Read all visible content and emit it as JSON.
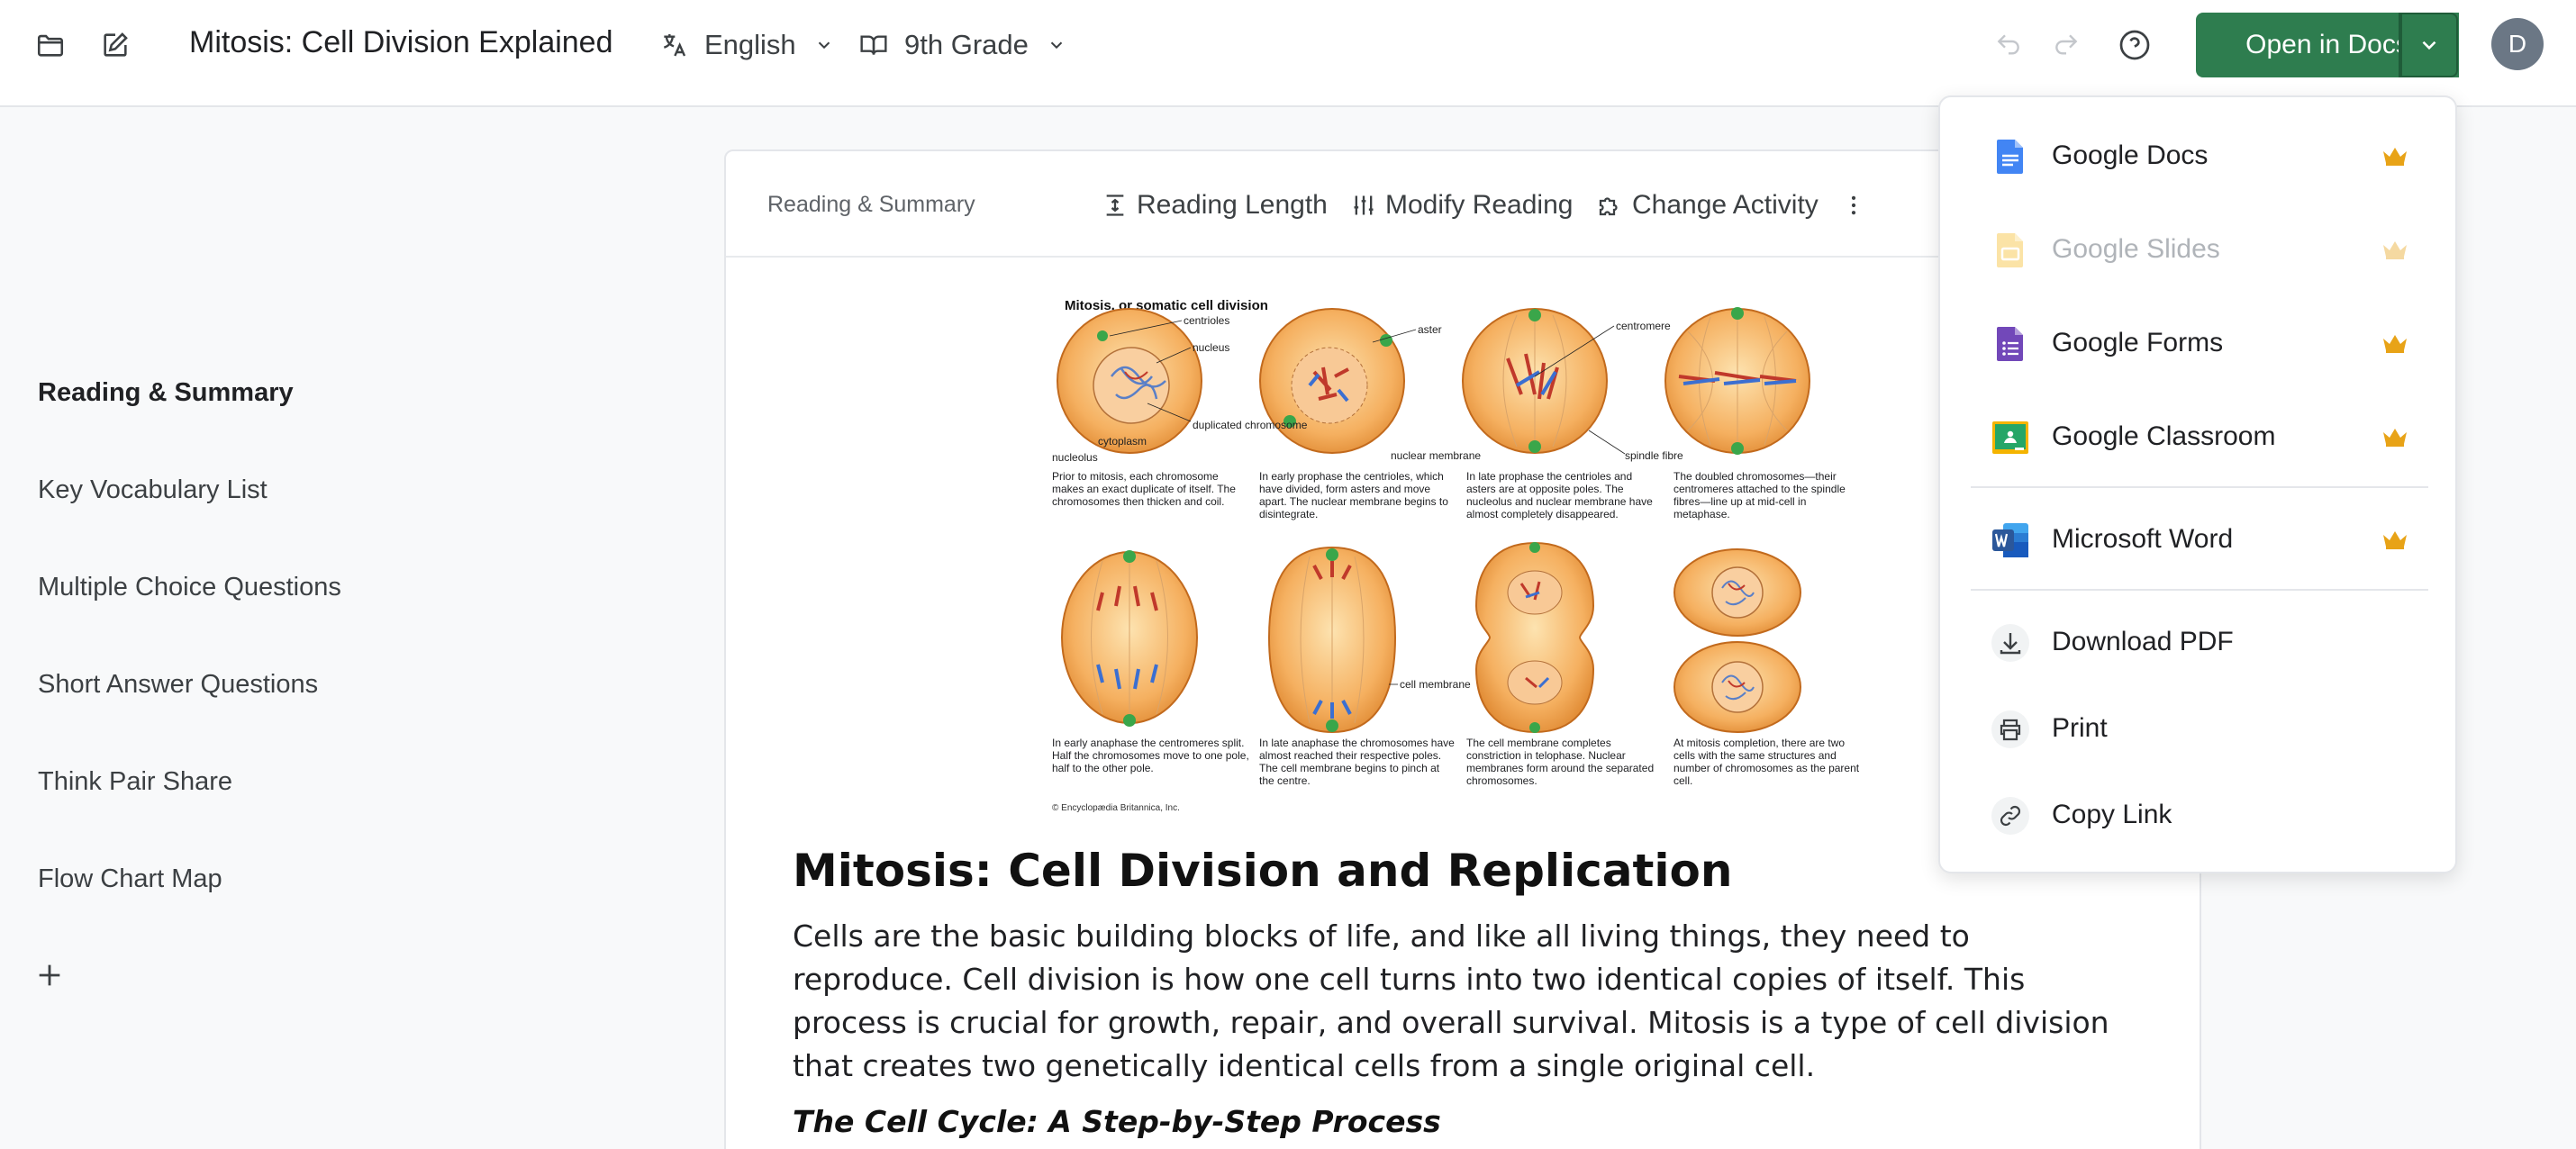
{
  "header": {
    "title": "Mitosis: Cell Division Explained",
    "language": "English",
    "grade": "9th Grade",
    "open_button_label": "Open in Docs",
    "avatar_initial": "D"
  },
  "sidebar": {
    "items": [
      {
        "label": "Reading & Summary",
        "active": true
      },
      {
        "label": "Key Vocabulary List"
      },
      {
        "label": "Multiple Choice Questions"
      },
      {
        "label": "Short Answer Questions"
      },
      {
        "label": "Think Pair Share"
      },
      {
        "label": "Flow Chart Map"
      }
    ]
  },
  "card": {
    "section_label": "Reading & Summary",
    "tools": {
      "reading_length": "Reading Length",
      "modify_reading": "Modify Reading",
      "change_activity": "Change Activity"
    },
    "figure": {
      "title": "Mitosis, or somatic cell division",
      "labels": {
        "centrioles": "centrioles",
        "nucleus": "nucleus",
        "duplicated_chromosome": "duplicated chromosome",
        "cytoplasm": "cytoplasm",
        "nucleolus": "nucleolus",
        "aster": "aster",
        "nuclear_membrane": "nuclear membrane",
        "centromere": "centromere",
        "spindle_fibre": "spindle fibre",
        "cell_membrane": "cell membrane"
      },
      "captions": [
        "Prior to mitosis, each chromosome makes an exact duplicate of itself. The chromosomes then thicken and coil.",
        "In early prophase the centrioles, which have divided, form asters and move apart. The nuclear membrane begins to disintegrate.",
        "In late prophase the centrioles and asters are at opposite poles. The nucleolus and nuclear membrane have almost completely disappeared.",
        "The doubled chromosomes—their centromeres attached to the spindle fibres—line up at mid-cell in metaphase.",
        "In early anaphase the centromeres split. Half the chromosomes move to one pole, half to the other pole.",
        "In late anaphase the chromosomes have almost reached their respective poles. The cell membrane begins to pinch at the centre.",
        "The cell membrane completes constriction in telophase. Nuclear membranes form around the separated chromosomes.",
        "At mitosis completion, there are two cells with the same structures and number of chromosomes as the parent cell."
      ],
      "credit": "© Encyclopædia Britannica, Inc."
    },
    "article": {
      "title": "Mitosis: Cell Division and Replication",
      "body": "Cells are the basic building blocks of life, and like all living things, they need to reproduce. Cell division is how one cell turns into two identical copies of itself. This process is crucial for growth, repair, and overall survival. Mitosis is a type of cell division that creates two genetically identical cells from a single original cell.",
      "subheading": "The Cell Cycle: A Step-by-Step Process"
    }
  },
  "dropdown": {
    "items": [
      {
        "label": "Google Docs",
        "icon": "google-docs-icon",
        "premium": true,
        "disabled": false
      },
      {
        "label": "Google Slides",
        "icon": "google-slides-icon",
        "premium": true,
        "disabled": true
      },
      {
        "label": "Google Forms",
        "icon": "google-forms-icon",
        "premium": true,
        "disabled": false
      },
      {
        "label": "Google Classroom",
        "icon": "google-classroom-icon",
        "premium": true,
        "disabled": false
      },
      {
        "label": "Microsoft Word",
        "icon": "microsoft-word-icon",
        "premium": true,
        "disabled": false
      },
      {
        "label": "Download PDF",
        "icon": "download-icon"
      },
      {
        "label": "Print",
        "icon": "printer-icon"
      },
      {
        "label": "Copy Link",
        "icon": "link-icon"
      }
    ]
  },
  "colors": {
    "primary_green": "#2e7d4f",
    "crown": "#e8a317",
    "docs_blue": "#4285f4",
    "slides_yellow": "#f4c430",
    "forms_purple": "#7248b9",
    "classroom_green": "#25a667",
    "word_blue": "#2b579a"
  }
}
